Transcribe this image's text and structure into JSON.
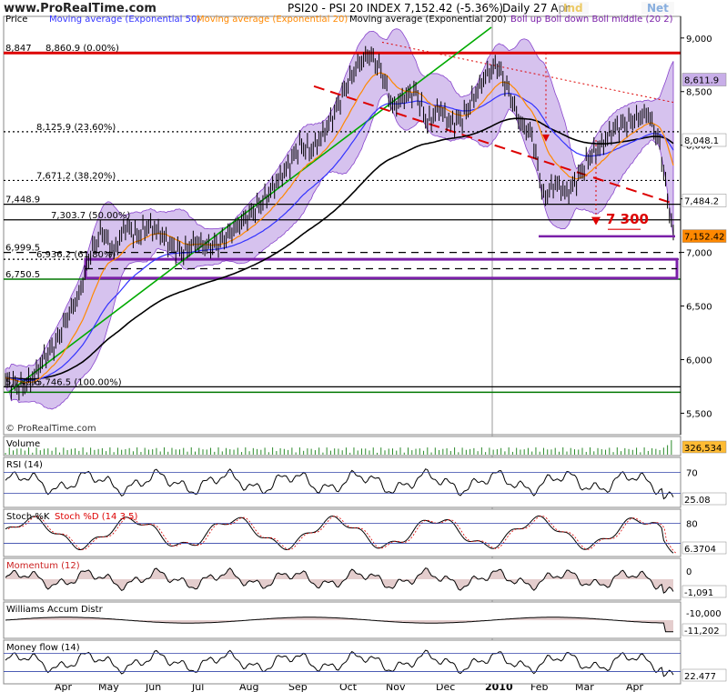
{
  "header": {
    "site": "www.ProRealTime.com",
    "title": "PSI20 - PSI 20 INDEX",
    "price_change": "7,152.42 (-5.36%)",
    "period": "Daily  27 Apr",
    "btn1": "Ind",
    "btn2": "Net"
  },
  "legend": {
    "price": "Price",
    "ma50": "Moving average (Exponential 50)",
    "ma20": "Moving average (Exponential 20)",
    "ma200": "Moving average (Exponential 200)",
    "boll": "Boll up Boll down Boll middle (20 2)"
  },
  "watermark": "© ProRealTime.com",
  "colors": {
    "price": "#000000",
    "ma50": "#3333ff",
    "ma20": "#ff8800",
    "ma200": "#000000",
    "bollinger_fill": "#c8aee8",
    "bollinger_line": "#8844cc",
    "uptrend": "#00aa00",
    "downtrend": "#dd0000",
    "zone": "#7a1fa8",
    "green_level": "#007700"
  },
  "chart_data": {
    "type": "line",
    "title": "PSI20 - PSI 20 INDEX",
    "x_labels": [
      "Apr",
      "May",
      "Jun",
      "Jul",
      "Aug",
      "Sep",
      "Oct",
      "Nov",
      "Dec",
      "2010",
      "Feb",
      "Mar",
      "Apr"
    ],
    "ylim": [
      5300,
      9100
    ],
    "y_ticks": [
      5500,
      6000,
      6500,
      7000,
      7500,
      8000,
      8500,
      9000
    ],
    "y_tick_labels": [
      "5,500",
      "6,000",
      "6,500",
      "7,000",
      "7,500",
      "8,000",
      "8,500",
      "9,000"
    ],
    "price_series": [
      [
        0,
        5800
      ],
      [
        8,
        5740
      ],
      [
        14,
        5820
      ],
      [
        20,
        6020
      ],
      [
        26,
        6150
      ],
      [
        32,
        6400
      ],
      [
        38,
        6600
      ],
      [
        44,
        7000
      ],
      [
        50,
        7200
      ],
      [
        56,
        7000
      ],
      [
        62,
        7250
      ],
      [
        68,
        7150
      ],
      [
        74,
        7250
      ],
      [
        80,
        7180
      ],
      [
        86,
        7050
      ],
      [
        92,
        7000
      ],
      [
        98,
        7100
      ],
      [
        104,
        7050
      ],
      [
        110,
        7080
      ],
      [
        116,
        7180
      ],
      [
        122,
        7280
      ],
      [
        128,
        7380
      ],
      [
        134,
        7500
      ],
      [
        140,
        7650
      ],
      [
        146,
        7800
      ],
      [
        152,
        8000
      ],
      [
        158,
        7950
      ],
      [
        164,
        8100
      ],
      [
        170,
        8300
      ],
      [
        176,
        8550
      ],
      [
        182,
        8750
      ],
      [
        188,
        8850
      ],
      [
        194,
        8700
      ],
      [
        200,
        8350
      ],
      [
        206,
        8450
      ],
      [
        212,
        8500
      ],
      [
        218,
        8200
      ],
      [
        224,
        8350
      ],
      [
        230,
        8200
      ],
      [
        236,
        8250
      ],
      [
        242,
        8450
      ],
      [
        248,
        8650
      ],
      [
        254,
        8750
      ],
      [
        260,
        8500
      ],
      [
        266,
        8200
      ],
      [
        272,
        8100
      ],
      [
        278,
        7500
      ],
      [
        284,
        7650
      ],
      [
        290,
        7550
      ],
      [
        296,
        7700
      ],
      [
        302,
        7900
      ],
      [
        308,
        8000
      ],
      [
        314,
        8150
      ],
      [
        320,
        8200
      ],
      [
        326,
        8250
      ],
      [
        332,
        8300
      ],
      [
        338,
        8000
      ],
      [
        342,
        7500
      ],
      [
        345,
        7152
      ]
    ],
    "last_price": 7152.42,
    "price_labels": [
      {
        "value": 8611.9,
        "label": "8,611.9"
      },
      {
        "value": 8048.1,
        "label": "8,048.1"
      },
      {
        "value": 7484.2,
        "label": "7,484.2"
      },
      {
        "value": 7152.42,
        "label": "7,152.42"
      }
    ],
    "fib_levels": [
      {
        "label": "8,860.9 (0.00%)",
        "value": 8860.9,
        "left_label": "8,847"
      },
      {
        "label": "8,125.9 (23.60%)",
        "value": 8125.9
      },
      {
        "label": "7,671.2 (38.20%)",
        "value": 7671.2
      },
      {
        "label": "7,303.7 (50.00%)",
        "value": 7303.7
      },
      {
        "label": "6,936.2 (61.80%)",
        "value": 6936.2
      },
      {
        "label": "5,746.5 (100.00%)",
        "value": 5746.5
      }
    ],
    "left_level_labels": [
      "7,448.9",
      "6,999.5",
      "6,750.5",
      "5,746.6"
    ],
    "target_annotation": "7 300",
    "panels": [
      {
        "name": "Volume",
        "value_label": "326,534"
      },
      {
        "name": "RSI (14)",
        "value_label": "25.08",
        "levels": [
          "70"
        ]
      },
      {
        "name": "Stoch %K",
        "extra": "Stoch %D (14 3 5)",
        "value_label": "6.3704",
        "levels": [
          "80"
        ]
      },
      {
        "name": "Momentum (12)",
        "value_label": "-1,091",
        "levels": [
          "0"
        ]
      },
      {
        "name": "Williams Accum Distr",
        "value_label": "-11,202",
        "levels": [
          "-10,000"
        ]
      },
      {
        "name": "Money flow (14)",
        "value_label": "22.477"
      }
    ]
  }
}
